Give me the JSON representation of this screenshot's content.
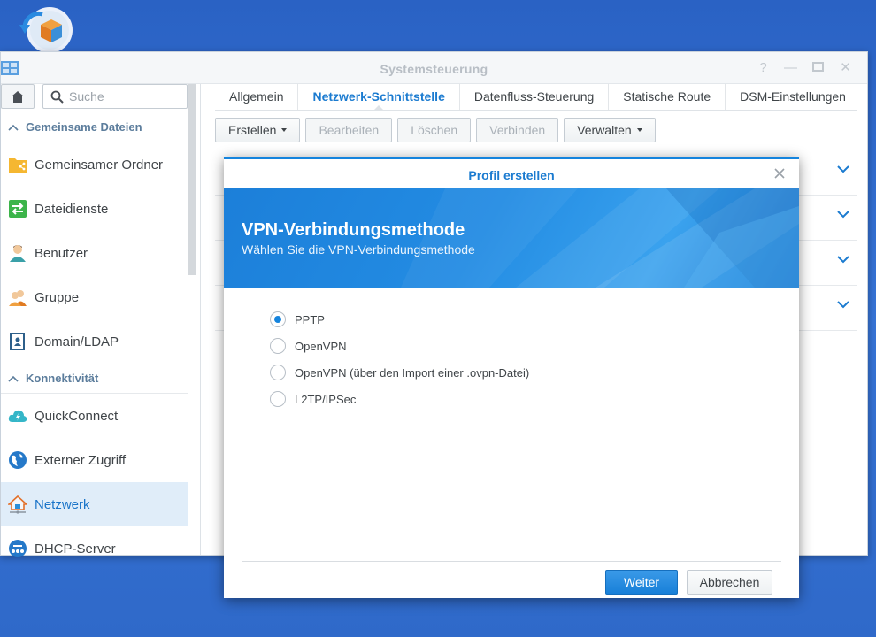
{
  "window": {
    "title": "Systemsteuerung"
  },
  "sidebar": {
    "search_placeholder": "Suche",
    "sections": [
      {
        "label": "Gemeinsame Dateien",
        "items": [
          {
            "label": "Gemeinsamer Ordner",
            "icon": "shared-folder-icon"
          },
          {
            "label": "Dateidienste",
            "icon": "file-services-icon"
          },
          {
            "label": "Benutzer",
            "icon": "user-icon"
          },
          {
            "label": "Gruppe",
            "icon": "group-icon"
          },
          {
            "label": "Domain/LDAP",
            "icon": "domain-ldap-icon"
          }
        ]
      },
      {
        "label": "Konnektivität",
        "items": [
          {
            "label": "QuickConnect",
            "icon": "quickconnect-icon"
          },
          {
            "label": "Externer Zugriff",
            "icon": "external-access-icon"
          },
          {
            "label": "Netzwerk",
            "icon": "network-icon",
            "active": true
          },
          {
            "label": "DHCP-Server",
            "icon": "dhcp-server-icon"
          }
        ]
      }
    ]
  },
  "tabs": [
    {
      "label": "Allgemein"
    },
    {
      "label": "Netzwerk-Schnittstelle",
      "active": true
    },
    {
      "label": "Datenfluss-Steuerung"
    },
    {
      "label": "Statische Route"
    },
    {
      "label": "DSM-Einstellungen"
    }
  ],
  "toolbar": {
    "create": "Erstellen",
    "edit": "Bearbeiten",
    "delete": "Löschen",
    "connect": "Verbinden",
    "manage": "Verwalten"
  },
  "dialog": {
    "title": "Profil erstellen",
    "banner_title": "VPN-Verbindungsmethode",
    "banner_subtitle": "Wählen Sie die VPN-Verbindungsmethode",
    "options": [
      {
        "label": "PPTP",
        "checked": true
      },
      {
        "label": "OpenVPN",
        "checked": false
      },
      {
        "label": "OpenVPN (über den Import einer .ovpn-Datei)",
        "checked": false
      },
      {
        "label": "L2TP/IPSec",
        "checked": false
      }
    ],
    "next_label": "Weiter",
    "cancel_label": "Abbrechen"
  },
  "colors": {
    "accent": "#1584dd",
    "desktop": "#2f69c9",
    "active_item_bg": "#e0edf9"
  }
}
